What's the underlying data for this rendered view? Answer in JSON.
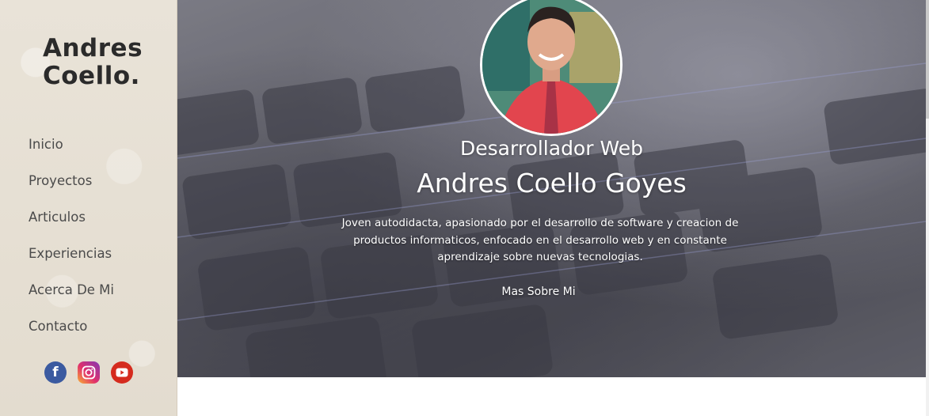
{
  "brand": {
    "line1": "Andres",
    "line2": "Coello."
  },
  "nav": {
    "items": [
      {
        "label": "Inicio"
      },
      {
        "label": "Proyectos"
      },
      {
        "label": "Articulos"
      },
      {
        "label": "Experiencias"
      },
      {
        "label": "Acerca De Mi"
      },
      {
        "label": "Contacto"
      }
    ]
  },
  "social": {
    "facebook": {
      "icon": "facebook-icon",
      "glyph": "f",
      "color": "#3b5aa0"
    },
    "instagram": {
      "icon": "instagram-icon",
      "color": "#e1306c"
    },
    "youtube": {
      "icon": "youtube-icon",
      "color": "#d52b1e"
    }
  },
  "hero": {
    "role": "Desarrollador Web",
    "name": "Andres Coello Goyes",
    "bio": "Joven autodidacta, apasionado por el desarrollo de software y creacion de productos informaticos, enfocado en el desarrollo web y en constante aprendizaje sobre nuevas tecnologias.",
    "cta": "Mas Sobre Mi"
  }
}
